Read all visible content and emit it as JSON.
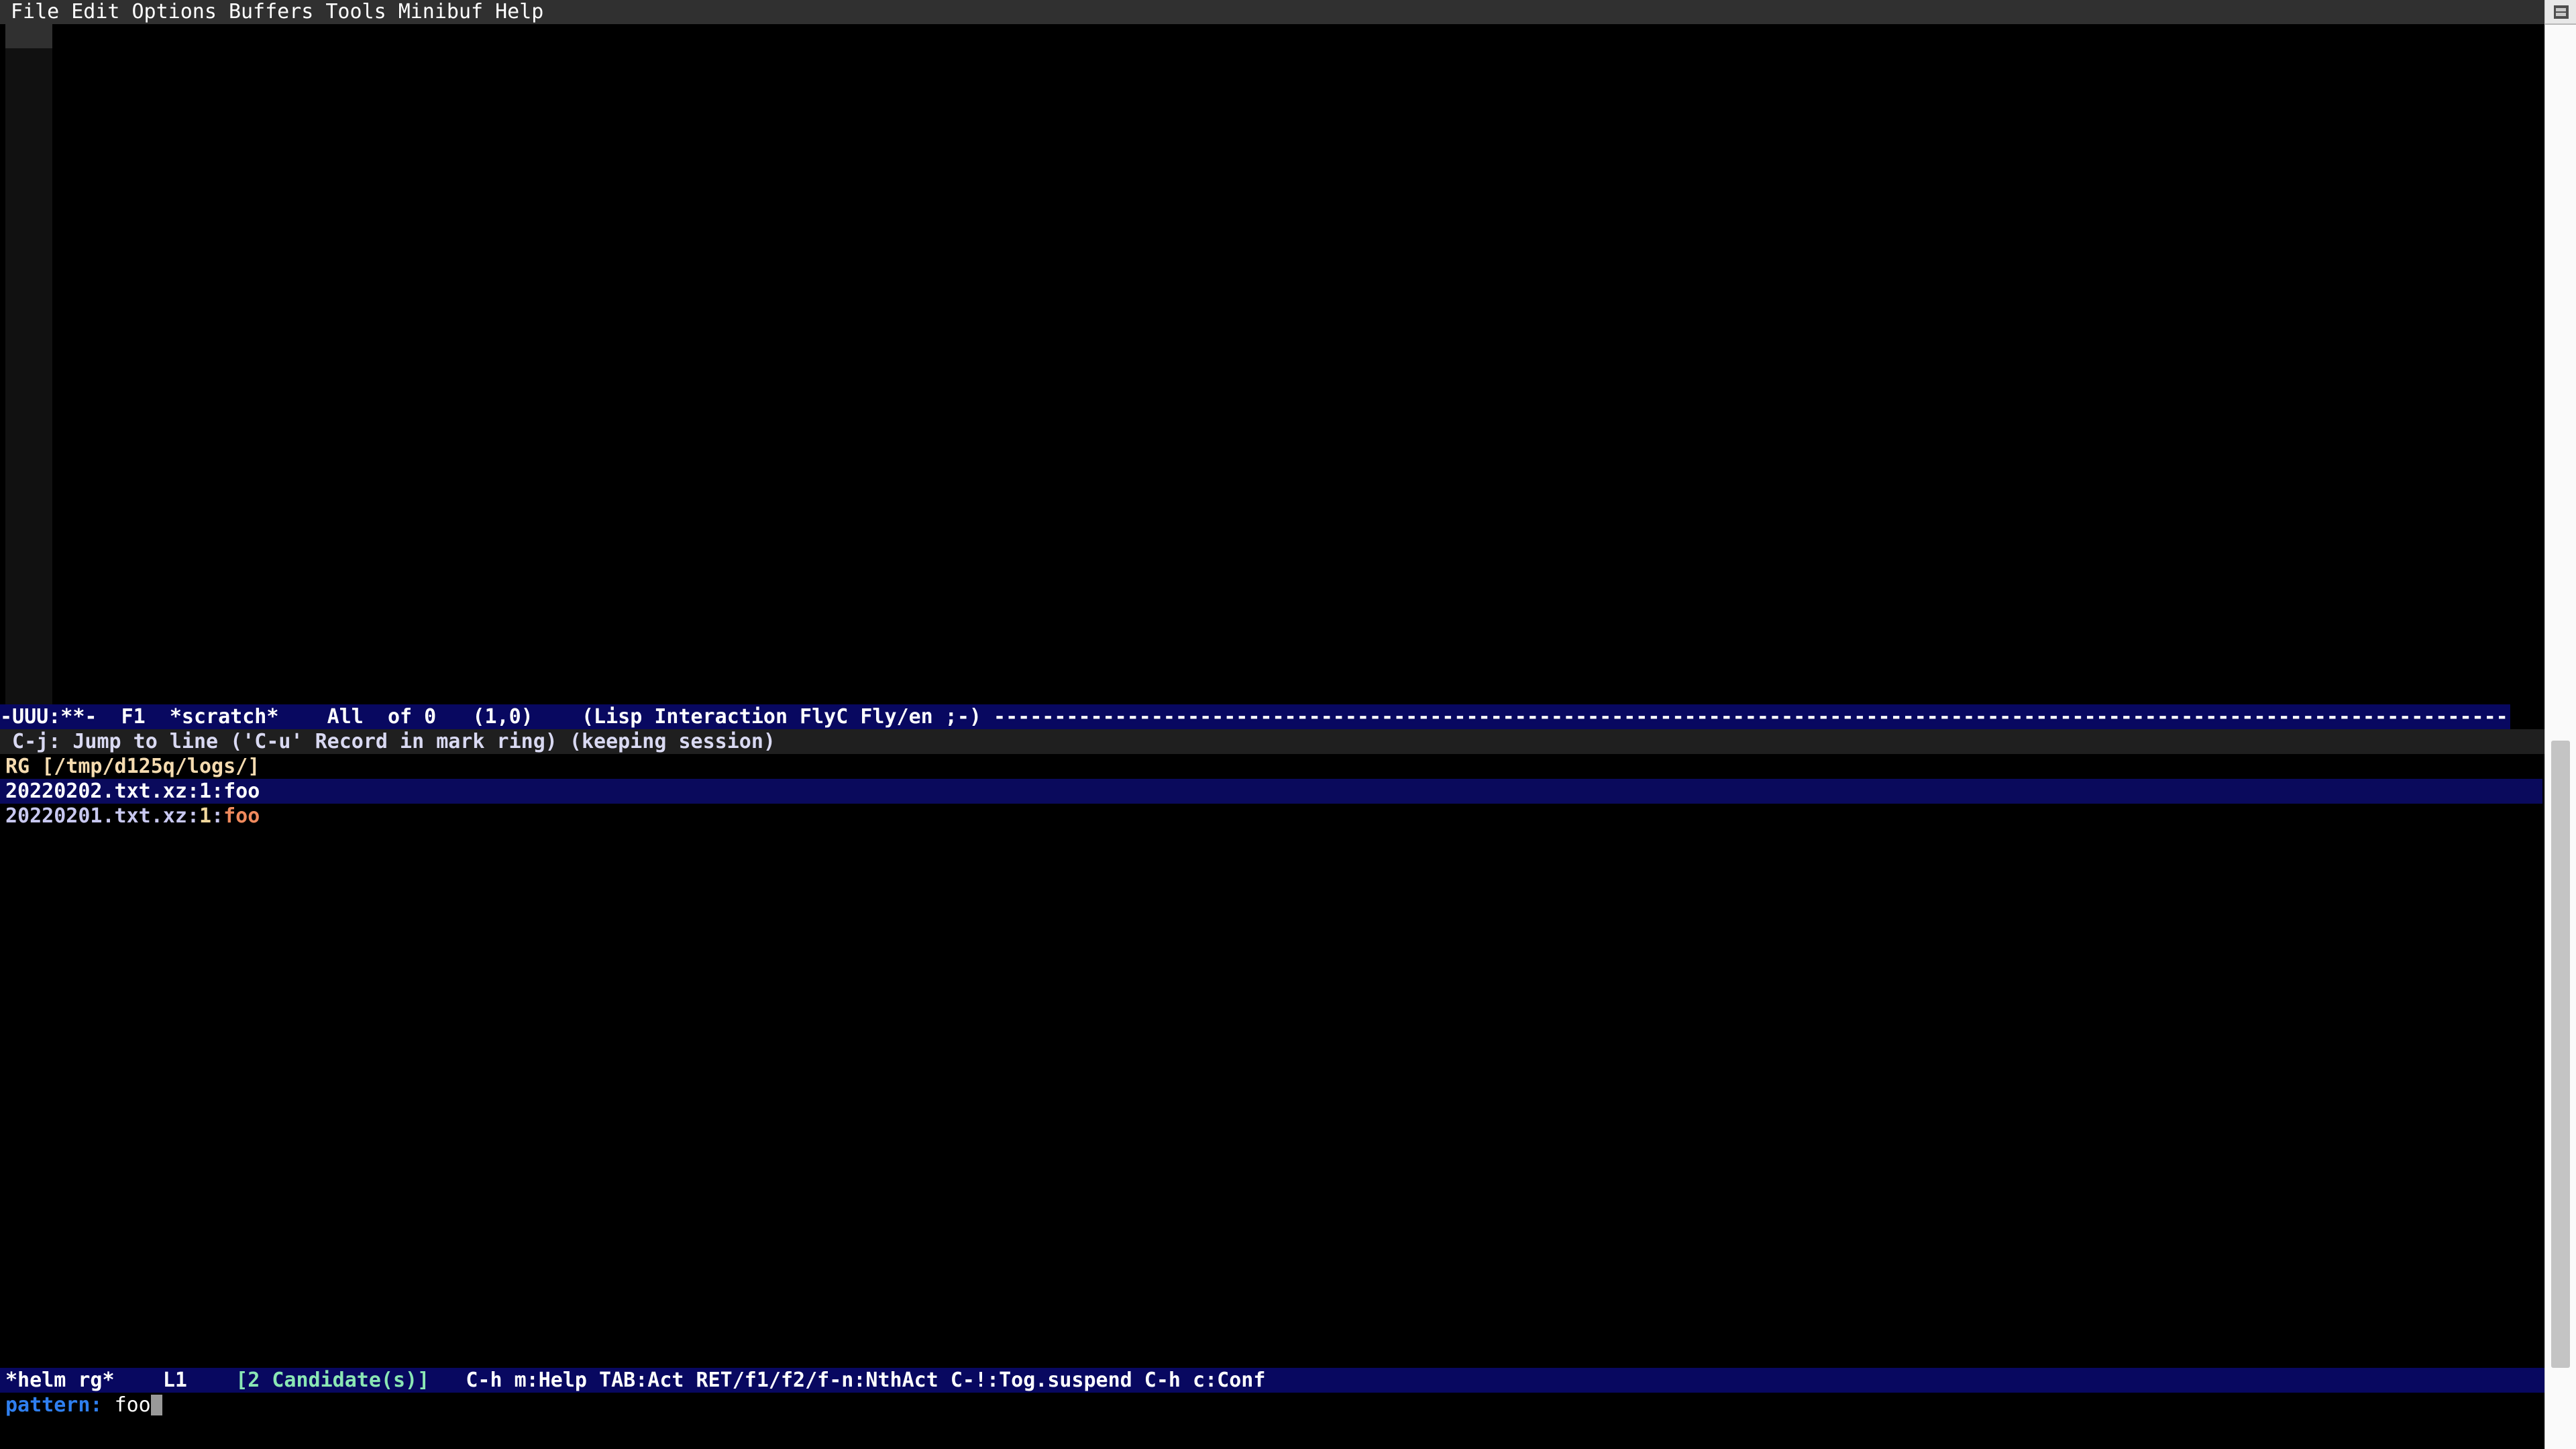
{
  "app": {
    "name": "GNU Emacs",
    "frame_background": "#000000"
  },
  "menu_bar": {
    "items": [
      {
        "label": "File"
      },
      {
        "label": "Edit"
      },
      {
        "label": "Options"
      },
      {
        "label": "Buffers"
      },
      {
        "label": "Tools"
      },
      {
        "label": "Minibuf"
      },
      {
        "label": "Help"
      }
    ]
  },
  "scratch_window": {
    "buffer_text": "",
    "mode_line": {
      "flags": "-UUU:**-",
      "frame_id": "F1",
      "buffer_name": "*scratch*",
      "position_all": "All",
      "of_size": "of 0",
      "line_col": "(1,0)",
      "modes": "(Lisp Interaction FlyC Fly/en ;-)",
      "full_text": "-UUU:**-  F1  *scratch*    All  of 0   (1,0)    (Lisp Interaction FlyC Fly/en ;-) ",
      "fill_char": "-",
      "background": "#080860",
      "foreground": "#ffffff"
    }
  },
  "header_line": {
    "text": " C-j: Jump to line ('C-u' Record in mark ring) (keeping session)",
    "background": "#1f1f1f",
    "foreground": "#d9d9f2"
  },
  "helm": {
    "source_header": "RG [/tmp/d125q/logs/]",
    "source_header_color": "#f5dbb0",
    "candidates": [
      {
        "file": "20220202.txt.xz",
        "sep1": ":",
        "line": "1",
        "sep2": ":",
        "match": "foo",
        "selected": true
      },
      {
        "file": "20220201.txt.xz",
        "sep1": ":",
        "line": "1",
        "sep2": ":",
        "match": "foo",
        "selected": false
      }
    ],
    "selection_background": "#0a0a5c",
    "match_color": "#f08a5d",
    "mode_line": {
      "buffer_name": "*helm rg*",
      "line_indicator": "L1",
      "candidate_count": "[2 Candidate(s)]",
      "keys": "C-h m:Help TAB:Act RET/f1/f2/f-n:NthAct C-!:Tog.suspend C-h c:Conf",
      "background": "#080860",
      "count_color": "#8ae6b4"
    }
  },
  "minibuffer": {
    "prompt": "pattern: ",
    "value": "foo",
    "prompt_color": "#2f7fef",
    "cursor_color": "#999999"
  },
  "scrollbar": {
    "head_icon": "scrollbar-head-icon",
    "thumb_color": "#c4c4c4",
    "track_color": "#fafafa"
  }
}
